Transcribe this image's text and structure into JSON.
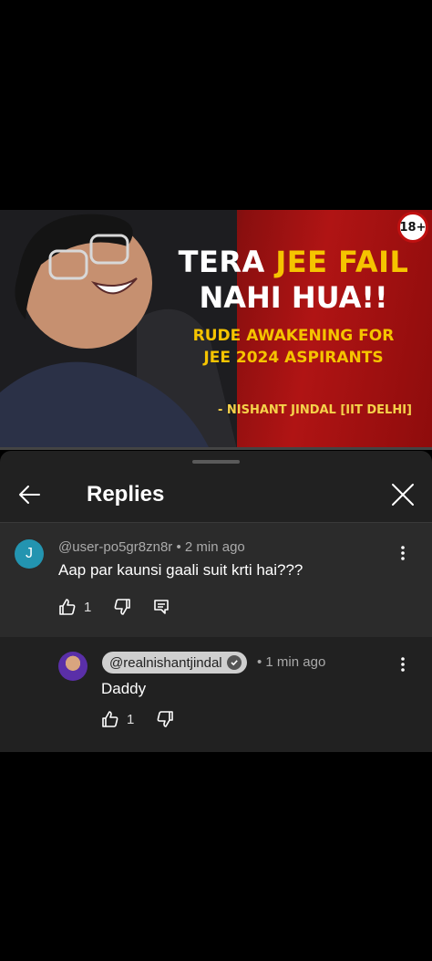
{
  "video": {
    "headline_part1": "TERA ",
    "headline_highlight": "JEE FAIL",
    "headline_line2": "NAHI HUA!!",
    "subtitle_line1": "RUDE AWAKENING FOR",
    "subtitle_line2": "JEE 2024 ASPIRANTS",
    "credit": "- NISHANT JINDAL [IIT DELHI]",
    "age_badge": "18+"
  },
  "panel": {
    "title": "Replies",
    "back_icon": "arrow-left-icon",
    "close_icon": "close-icon"
  },
  "comment": {
    "avatar_letter": "J",
    "author": "@user-po5gr8zn8r",
    "separator": " • ",
    "time": "2 min ago",
    "text": "Aap par kaunsi gaali suit krti hai???",
    "likes": "1"
  },
  "reply": {
    "author": "@realnishantjindal",
    "time_prefix": "• ",
    "time": "1 min ago",
    "text": "Daddy",
    "likes": "1"
  },
  "colors": {
    "panel_bg": "#212121",
    "comment_bg": "#2b2b2b",
    "avatar_j": "#2394b0",
    "accent_yellow": "#f5c400",
    "thumbnail_red": "#b01414"
  }
}
